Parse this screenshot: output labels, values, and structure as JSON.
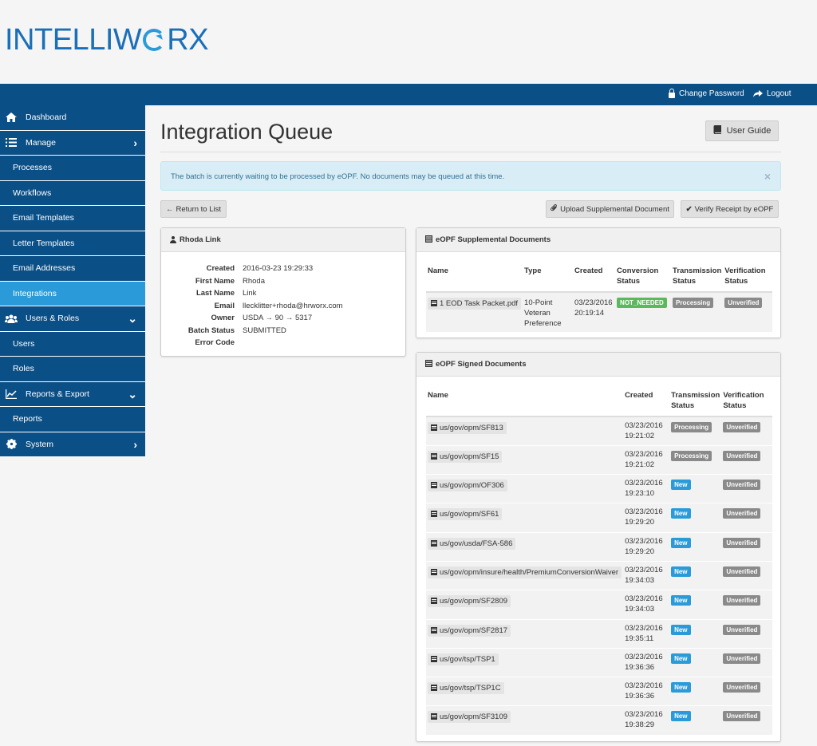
{
  "brand": {
    "left": "INTELLIW",
    "right": "RX"
  },
  "topbar": {
    "change_password": "Change Password",
    "logout": "Logout"
  },
  "sidebar": {
    "items": [
      {
        "label": "Dashboard"
      },
      {
        "label": "Manage"
      },
      {
        "label": "Processes"
      },
      {
        "label": "Workflows"
      },
      {
        "label": "Email Templates"
      },
      {
        "label": "Letter Templates"
      },
      {
        "label": "Email Addresses"
      },
      {
        "label": "Integrations"
      },
      {
        "label": "Users & Roles"
      },
      {
        "label": "Users"
      },
      {
        "label": "Roles"
      },
      {
        "label": "Reports & Export"
      },
      {
        "label": "Reports"
      },
      {
        "label": "System"
      }
    ]
  },
  "page": {
    "title": "Integration Queue",
    "user_guide": "User Guide",
    "alert": "The batch is currently waiting to be processed by eOPF. No documents may be queued at this time.",
    "alert_close": "×",
    "return_to_list": "Return to List",
    "upload_supplemental": "Upload Supplemental Document",
    "verify_receipt": "Verify Receipt by eOPF"
  },
  "person": {
    "name": "Rhoda Link",
    "fields": [
      {
        "k": "Created",
        "v": "2016-03-23 19:29:33"
      },
      {
        "k": "First Name",
        "v": "Rhoda"
      },
      {
        "k": "Last Name",
        "v": "Link"
      },
      {
        "k": "Email",
        "v": "llecklitter+rhoda@hrworx.com"
      },
      {
        "k": "Owner",
        "v": "USDA → 90 → 5317"
      },
      {
        "k": "Batch Status",
        "v": "SUBMITTED"
      },
      {
        "k": "Error Code",
        "v": ""
      }
    ]
  },
  "supplemental": {
    "title": "eOPF Supplemental Documents",
    "headers": {
      "name": "Name",
      "type": "Type",
      "created": "Created",
      "conversion": "Conversion Status",
      "transmission": "Transmission Status",
      "verification": "Verification Status"
    },
    "rows": [
      {
        "name": "1 EOD Task Packet.pdf",
        "type": "10-Point Veteran Preference",
        "created_date": "03/23/2016",
        "created_time": "20:19:14",
        "conversion": "NOT_NEEDED",
        "transmission": "Processing",
        "verification": "Unverified"
      }
    ]
  },
  "signed": {
    "title": "eOPF Signed Documents",
    "headers": {
      "name": "Name",
      "created": "Created",
      "transmission": "Transmission Status",
      "verification": "Verification Status"
    },
    "rows": [
      {
        "name": "us/gov/opm/SF813",
        "date": "03/23/2016",
        "time": "19:21:02",
        "transmission": "Processing",
        "verification": "Unverified"
      },
      {
        "name": "us/gov/opm/SF15",
        "date": "03/23/2016",
        "time": "19:21:02",
        "transmission": "Processing",
        "verification": "Unverified"
      },
      {
        "name": "us/gov/opm/OF306",
        "date": "03/23/2016",
        "time": "19:23:10",
        "transmission": "New",
        "verification": "Unverified"
      },
      {
        "name": "us/gov/opm/SF61",
        "date": "03/23/2016",
        "time": "19:29:20",
        "transmission": "New",
        "verification": "Unverified"
      },
      {
        "name": "us/gov/usda/FSA-586",
        "date": "03/23/2016",
        "time": "19:29:20",
        "transmission": "New",
        "verification": "Unverified"
      },
      {
        "name": "us/gov/opm/insure/health/PremiumConversionWaiver",
        "date": "03/23/2016",
        "time": "19:34:03",
        "transmission": "New",
        "verification": "Unverified"
      },
      {
        "name": "us/gov/opm/SF2809",
        "date": "03/23/2016",
        "time": "19:34:03",
        "transmission": "New",
        "verification": "Unverified"
      },
      {
        "name": "us/gov/opm/SF2817",
        "date": "03/23/2016",
        "time": "19:35:11",
        "transmission": "New",
        "verification": "Unverified"
      },
      {
        "name": "us/gov/tsp/TSP1",
        "date": "03/23/2016",
        "time": "19:36:36",
        "transmission": "New",
        "verification": "Unverified"
      },
      {
        "name": "us/gov/tsp/TSP1C",
        "date": "03/23/2016",
        "time": "19:36:36",
        "transmission": "New",
        "verification": "Unverified"
      },
      {
        "name": "us/gov/opm/SF3109",
        "date": "03/23/2016",
        "time": "19:38:29",
        "transmission": "New",
        "verification": "Unverified"
      }
    ]
  },
  "colors": {
    "nav": "#0b4f87",
    "nav_active": "#2a9bd8",
    "label_new": "#2a9bd8",
    "label_gray": "#8a8a8a",
    "label_green": "#5cb85c"
  }
}
